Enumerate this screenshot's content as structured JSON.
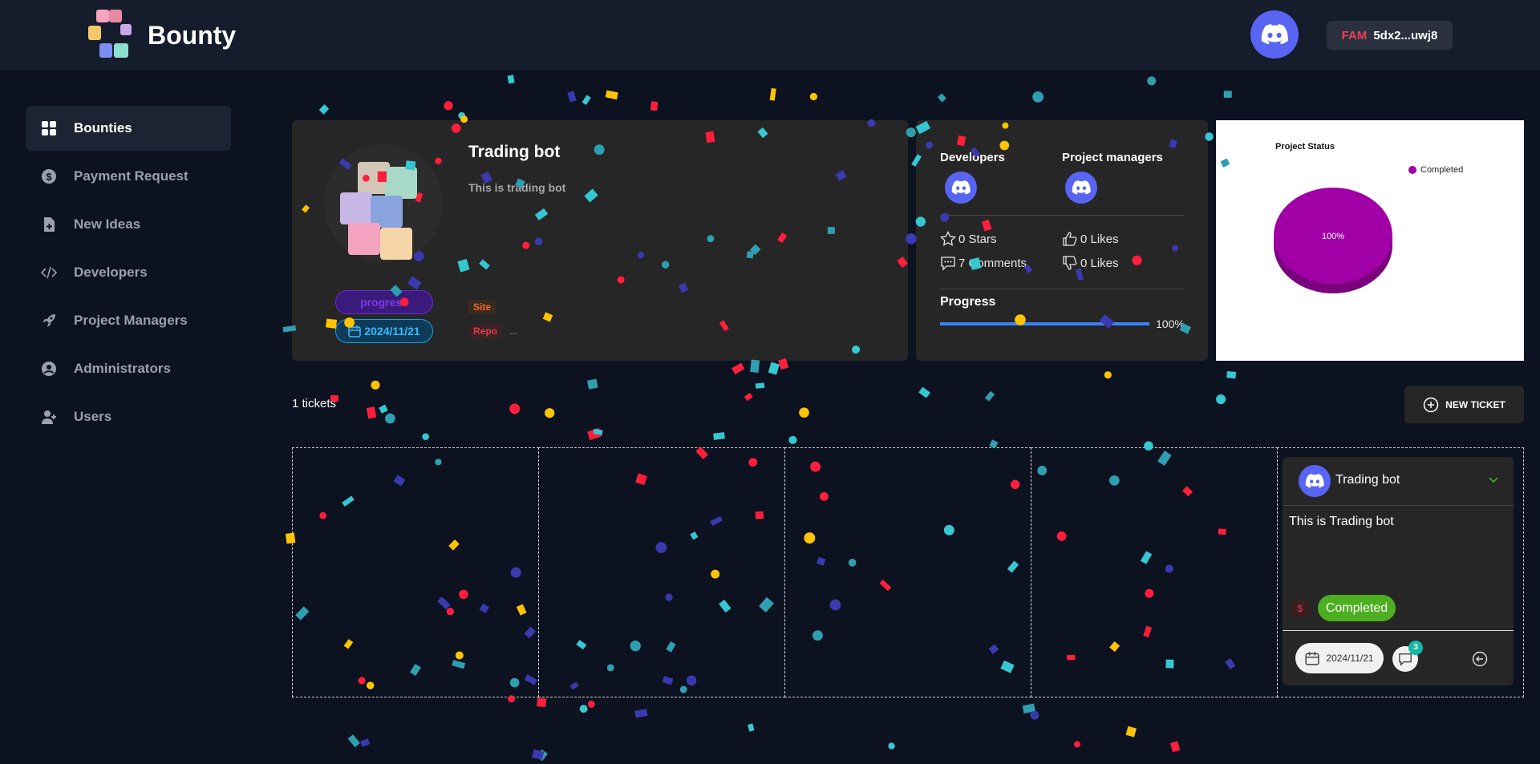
{
  "header": {
    "brand": "Bounty",
    "wallet_tag": "FAM",
    "wallet_address": "5dx2...uwj8"
  },
  "sidebar": {
    "items": [
      {
        "label": "Bounties",
        "icon": "grid-icon",
        "active": true
      },
      {
        "label": "Payment Request",
        "icon": "dollar-circle-icon",
        "active": false
      },
      {
        "label": "New Ideas",
        "icon": "file-plus-icon",
        "active": false
      },
      {
        "label": "Developers",
        "icon": "code-icon",
        "active": false
      },
      {
        "label": "Project Managers",
        "icon": "rocket-icon",
        "active": false
      },
      {
        "label": "Administrators",
        "icon": "user-circle-icon",
        "active": false
      },
      {
        "label": "Users",
        "icon": "user-plus-icon",
        "active": false
      }
    ]
  },
  "project": {
    "title": "Trading bot",
    "description": "This is trading bot",
    "status_badge": "progress",
    "date": "2024/11/21",
    "link_site": "Site",
    "link_repo": "Repo",
    "link_more": "..."
  },
  "team": {
    "developers_label": "Developers",
    "managers_label": "Project managers",
    "stars": "0 Stars",
    "likes": "0 Likes",
    "comments": "7 Comments",
    "dislikes": "0 Likes",
    "progress_label": "Progress",
    "progress_value": 100,
    "progress_text": "100%"
  },
  "chart_data": {
    "type": "pie",
    "title": "Project Status",
    "categories": [
      "Completed"
    ],
    "values": [
      100
    ],
    "labels": [
      "100%"
    ],
    "colors": [
      "#a000a6"
    ],
    "legend": "top-right"
  },
  "tickets": {
    "count_text": "1 tickets",
    "new_button": "NEW TICKET",
    "card": {
      "title": "Trading bot",
      "description": "This is Trading bot",
      "currency": "$",
      "status": "Completed",
      "date": "2024/11/21",
      "comment_count": "3"
    }
  },
  "colors": {
    "discord": "#5865f2",
    "accent_blue": "#3b82f6",
    "status_green": "#4caf1f",
    "pie_purple": "#a000a6"
  }
}
